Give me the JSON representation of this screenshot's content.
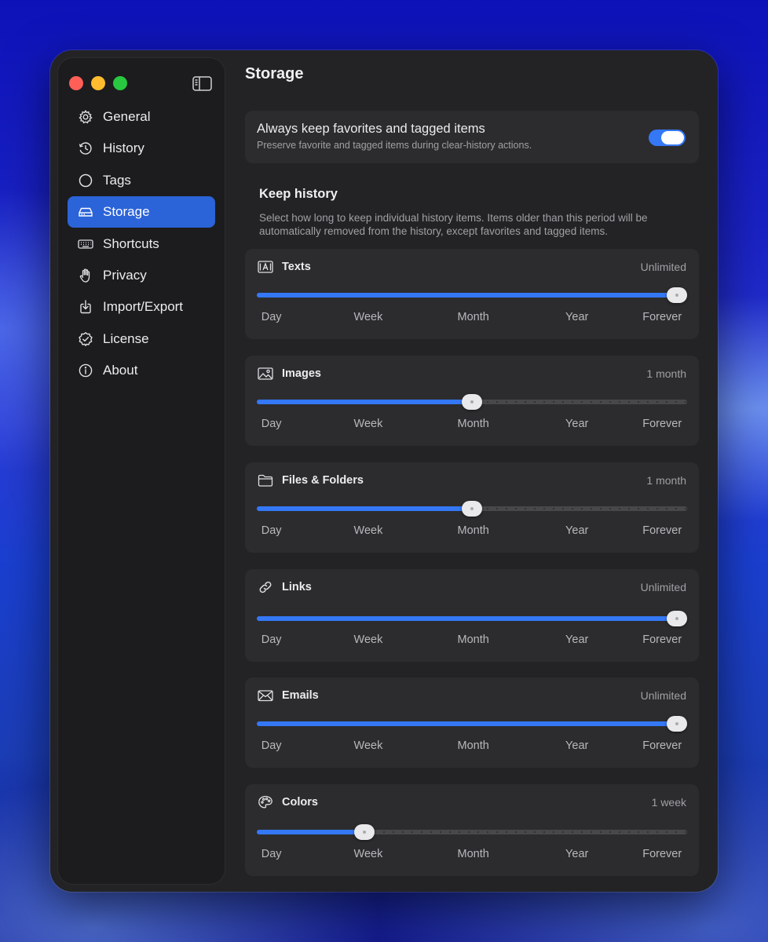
{
  "window": {
    "title": "Storage"
  },
  "sidebar": {
    "items": [
      {
        "label": "General",
        "icon": "gear-icon"
      },
      {
        "label": "History",
        "icon": "clock-history-icon"
      },
      {
        "label": "Tags",
        "icon": "circle-icon"
      },
      {
        "label": "Storage",
        "icon": "drive-icon",
        "active": true
      },
      {
        "label": "Shortcuts",
        "icon": "keyboard-icon"
      },
      {
        "label": "Privacy",
        "icon": "hand-icon"
      },
      {
        "label": "Import/Export",
        "icon": "import-export-icon"
      },
      {
        "label": "License",
        "icon": "checkmark-seal-icon"
      },
      {
        "label": "About",
        "icon": "info-icon"
      }
    ]
  },
  "favorites": {
    "title": "Always keep favorites and tagged items",
    "subtitle": "Preserve favorite and tagged items during clear-history actions.",
    "enabled": true
  },
  "keep_history": {
    "title": "Keep history",
    "description": "Select how long to keep individual history items. Items older than this period will be automatically removed from the history, except favorites and tagged items."
  },
  "scale_labels": [
    "Day",
    "Week",
    "Month",
    "Year",
    "Forever"
  ],
  "sliders": [
    {
      "label": "Texts",
      "icon": "text-box-icon",
      "value_text": "Unlimited",
      "level": 1.0
    },
    {
      "label": "Images",
      "icon": "photo-icon",
      "value_text": "1 month",
      "level": 0.5
    },
    {
      "label": "Files & Folders",
      "icon": "folder-icon",
      "value_text": "1 month",
      "level": 0.5
    },
    {
      "label": "Links",
      "icon": "link-icon",
      "value_text": "Unlimited",
      "level": 1.0
    },
    {
      "label": "Emails",
      "icon": "envelope-icon",
      "value_text": "Unlimited",
      "level": 1.0
    },
    {
      "label": "Colors",
      "icon": "palette-icon",
      "value_text": "1 week",
      "level": 0.25
    }
  ],
  "colors": {
    "accent": "#3478f6",
    "sidebar_active": "#2b63d9"
  }
}
